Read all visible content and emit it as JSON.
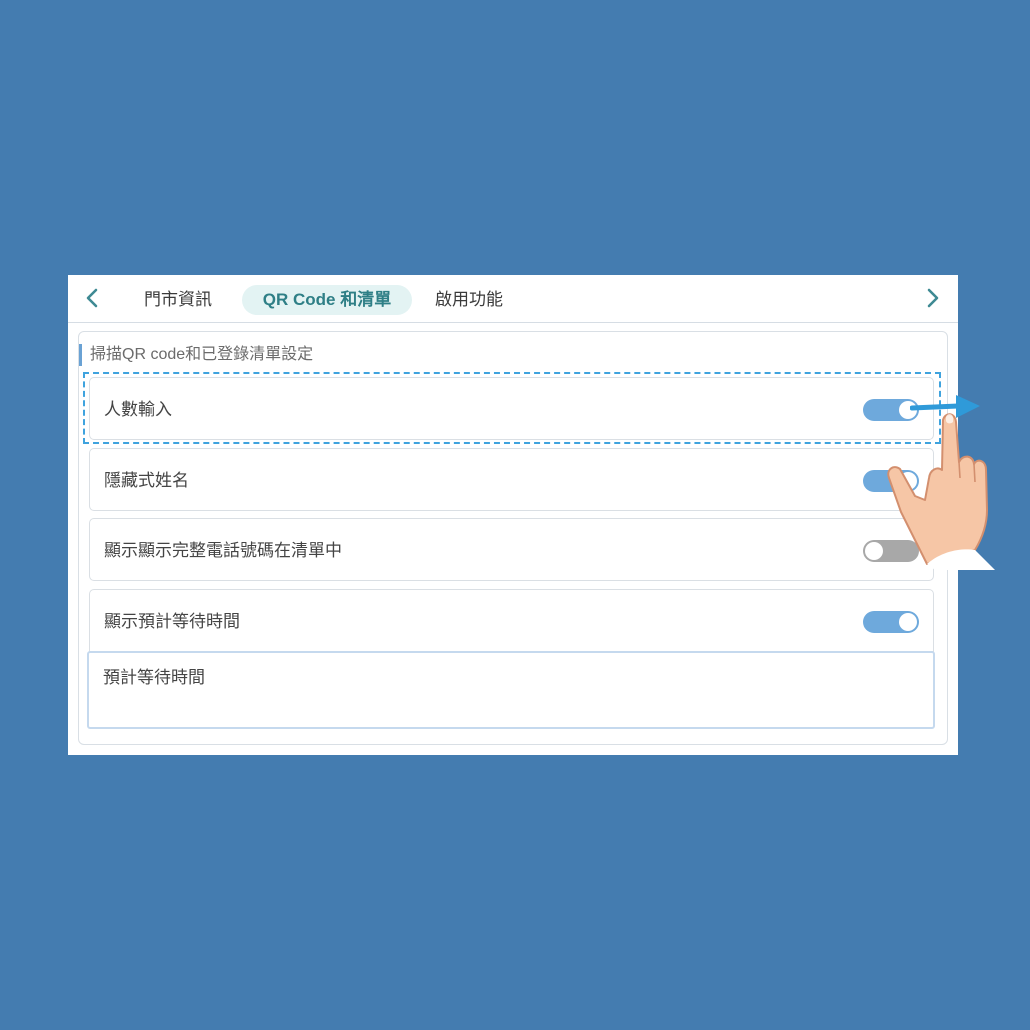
{
  "tabs": {
    "prev_icon": "chevron-left-icon",
    "next_icon": "chevron-right-icon",
    "items": [
      {
        "label": "門市資訊",
        "active": false
      },
      {
        "label": "QR Code 和清單",
        "active": true
      },
      {
        "label": "啟用功能",
        "active": false
      }
    ]
  },
  "section": {
    "title": "掃描QR code和已登錄清單設定"
  },
  "settings": [
    {
      "label": "人數輸入",
      "enabled": true
    },
    {
      "label": "隱藏式姓名",
      "enabled": true
    },
    {
      "label": "顯示顯示完整電話號碼在清單中",
      "enabled": false
    },
    {
      "label": "顯示預計等待時間",
      "enabled": true
    }
  ],
  "wait_time_input": {
    "placeholder": "預計等待時間"
  },
  "colors": {
    "background": "#447cb0",
    "accent": "#6ea9dc",
    "active_tab_text": "#2e7f86",
    "highlight": "#3fa3de"
  },
  "overlay": {
    "gesture": "swipe-right",
    "icons": [
      "swipe-arrow-icon",
      "pointing-hand-icon"
    ]
  }
}
